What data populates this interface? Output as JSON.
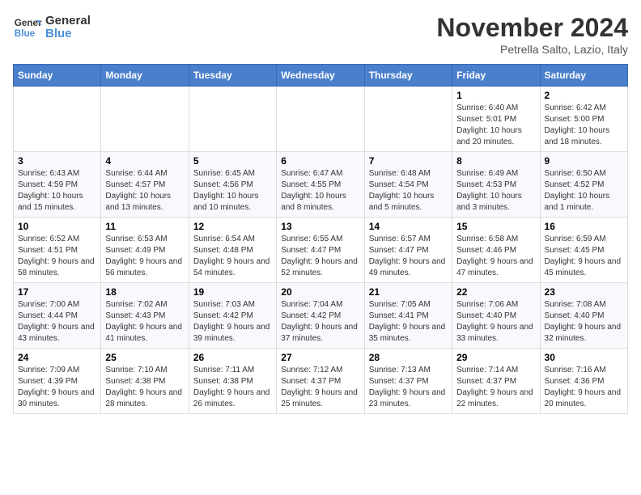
{
  "logo": {
    "line1": "General",
    "line2": "Blue"
  },
  "title": "November 2024",
  "location": "Petrella Salto, Lazio, Italy",
  "weekdays": [
    "Sunday",
    "Monday",
    "Tuesday",
    "Wednesday",
    "Thursday",
    "Friday",
    "Saturday"
  ],
  "weeks": [
    [
      {
        "day": "",
        "info": ""
      },
      {
        "day": "",
        "info": ""
      },
      {
        "day": "",
        "info": ""
      },
      {
        "day": "",
        "info": ""
      },
      {
        "day": "",
        "info": ""
      },
      {
        "day": "1",
        "info": "Sunrise: 6:40 AM\nSunset: 5:01 PM\nDaylight: 10 hours and 20 minutes."
      },
      {
        "day": "2",
        "info": "Sunrise: 6:42 AM\nSunset: 5:00 PM\nDaylight: 10 hours and 18 minutes."
      }
    ],
    [
      {
        "day": "3",
        "info": "Sunrise: 6:43 AM\nSunset: 4:59 PM\nDaylight: 10 hours and 15 minutes."
      },
      {
        "day": "4",
        "info": "Sunrise: 6:44 AM\nSunset: 4:57 PM\nDaylight: 10 hours and 13 minutes."
      },
      {
        "day": "5",
        "info": "Sunrise: 6:45 AM\nSunset: 4:56 PM\nDaylight: 10 hours and 10 minutes."
      },
      {
        "day": "6",
        "info": "Sunrise: 6:47 AM\nSunset: 4:55 PM\nDaylight: 10 hours and 8 minutes."
      },
      {
        "day": "7",
        "info": "Sunrise: 6:48 AM\nSunset: 4:54 PM\nDaylight: 10 hours and 5 minutes."
      },
      {
        "day": "8",
        "info": "Sunrise: 6:49 AM\nSunset: 4:53 PM\nDaylight: 10 hours and 3 minutes."
      },
      {
        "day": "9",
        "info": "Sunrise: 6:50 AM\nSunset: 4:52 PM\nDaylight: 10 hours and 1 minute."
      }
    ],
    [
      {
        "day": "10",
        "info": "Sunrise: 6:52 AM\nSunset: 4:51 PM\nDaylight: 9 hours and 58 minutes."
      },
      {
        "day": "11",
        "info": "Sunrise: 6:53 AM\nSunset: 4:49 PM\nDaylight: 9 hours and 56 minutes."
      },
      {
        "day": "12",
        "info": "Sunrise: 6:54 AM\nSunset: 4:48 PM\nDaylight: 9 hours and 54 minutes."
      },
      {
        "day": "13",
        "info": "Sunrise: 6:55 AM\nSunset: 4:47 PM\nDaylight: 9 hours and 52 minutes."
      },
      {
        "day": "14",
        "info": "Sunrise: 6:57 AM\nSunset: 4:47 PM\nDaylight: 9 hours and 49 minutes."
      },
      {
        "day": "15",
        "info": "Sunrise: 6:58 AM\nSunset: 4:46 PM\nDaylight: 9 hours and 47 minutes."
      },
      {
        "day": "16",
        "info": "Sunrise: 6:59 AM\nSunset: 4:45 PM\nDaylight: 9 hours and 45 minutes."
      }
    ],
    [
      {
        "day": "17",
        "info": "Sunrise: 7:00 AM\nSunset: 4:44 PM\nDaylight: 9 hours and 43 minutes."
      },
      {
        "day": "18",
        "info": "Sunrise: 7:02 AM\nSunset: 4:43 PM\nDaylight: 9 hours and 41 minutes."
      },
      {
        "day": "19",
        "info": "Sunrise: 7:03 AM\nSunset: 4:42 PM\nDaylight: 9 hours and 39 minutes."
      },
      {
        "day": "20",
        "info": "Sunrise: 7:04 AM\nSunset: 4:42 PM\nDaylight: 9 hours and 37 minutes."
      },
      {
        "day": "21",
        "info": "Sunrise: 7:05 AM\nSunset: 4:41 PM\nDaylight: 9 hours and 35 minutes."
      },
      {
        "day": "22",
        "info": "Sunrise: 7:06 AM\nSunset: 4:40 PM\nDaylight: 9 hours and 33 minutes."
      },
      {
        "day": "23",
        "info": "Sunrise: 7:08 AM\nSunset: 4:40 PM\nDaylight: 9 hours and 32 minutes."
      }
    ],
    [
      {
        "day": "24",
        "info": "Sunrise: 7:09 AM\nSunset: 4:39 PM\nDaylight: 9 hours and 30 minutes."
      },
      {
        "day": "25",
        "info": "Sunrise: 7:10 AM\nSunset: 4:38 PM\nDaylight: 9 hours and 28 minutes."
      },
      {
        "day": "26",
        "info": "Sunrise: 7:11 AM\nSunset: 4:38 PM\nDaylight: 9 hours and 26 minutes."
      },
      {
        "day": "27",
        "info": "Sunrise: 7:12 AM\nSunset: 4:37 PM\nDaylight: 9 hours and 25 minutes."
      },
      {
        "day": "28",
        "info": "Sunrise: 7:13 AM\nSunset: 4:37 PM\nDaylight: 9 hours and 23 minutes."
      },
      {
        "day": "29",
        "info": "Sunrise: 7:14 AM\nSunset: 4:37 PM\nDaylight: 9 hours and 22 minutes."
      },
      {
        "day": "30",
        "info": "Sunrise: 7:16 AM\nSunset: 4:36 PM\nDaylight: 9 hours and 20 minutes."
      }
    ]
  ]
}
